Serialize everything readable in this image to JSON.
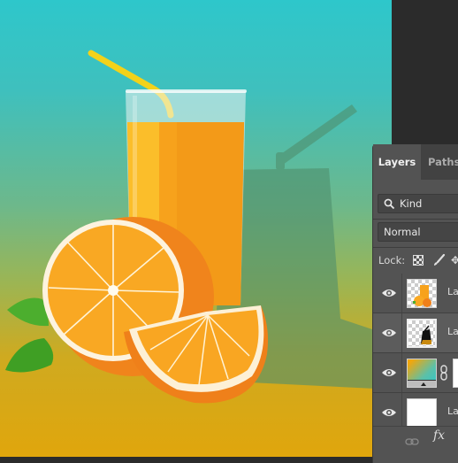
{
  "canvas": {
    "background_gradient": [
      "#2ec7cb",
      "#6db88b",
      "#e0a60c"
    ],
    "artwork": "orange-juice-glass-with-straw-and-orange-slices"
  },
  "layers_panel": {
    "tabs": [
      {
        "label": "Layers",
        "active": true
      },
      {
        "label": "Paths",
        "active": false
      }
    ],
    "filter": {
      "icon": "search-icon",
      "value": "Kind"
    },
    "blend_mode": "Normal",
    "lock_label": "Lock:",
    "lock_icons": [
      "lock-transparent-pixels-icon",
      "lock-image-pixels-icon",
      "lock-position-icon"
    ],
    "layers": [
      {
        "name": "La",
        "thumb": "juice-composition",
        "visible": true,
        "selected": false
      },
      {
        "name": "La",
        "thumb": "shadow-mask",
        "visible": true,
        "selected": true
      },
      {
        "name": "",
        "thumb": "gradient-fill",
        "visible": true,
        "selected": false,
        "has_mask_link": true
      },
      {
        "name": "La",
        "thumb": "white-fill",
        "visible": true,
        "selected": false
      }
    ],
    "footer_icons": [
      "link-layers-icon",
      "fx-icon"
    ],
    "fx_label": "fx"
  }
}
